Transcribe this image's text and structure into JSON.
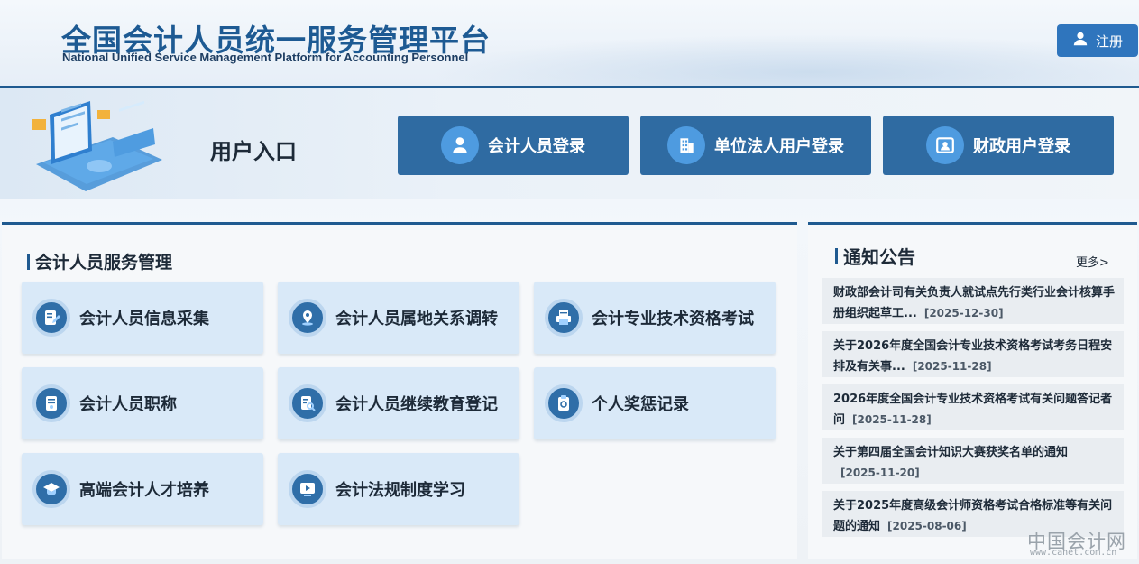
{
  "header": {
    "title": "全国会计人员统一服务管理平台",
    "subtitle": "National Unified Service Management Platform for Accounting Personnel",
    "register_label": "注册"
  },
  "entry": {
    "title": "用户入口",
    "logins": [
      {
        "label": "会计人员登录",
        "icon": "person-icon"
      },
      {
        "label": "单位法人用户登录",
        "icon": "building-icon"
      },
      {
        "label": "财政用户登录",
        "icon": "id-card-icon"
      }
    ]
  },
  "services": {
    "title": "会计人员服务管理",
    "items": [
      {
        "label": "会计人员信息采集",
        "icon": "form-edit-icon"
      },
      {
        "label": "会计人员属地关系调转",
        "icon": "location-icon"
      },
      {
        "label": "会计专业技术资格考试",
        "icon": "printer-icon"
      },
      {
        "label": "会计人员职称",
        "icon": "certificate-icon"
      },
      {
        "label": "会计人员继续教育登记",
        "icon": "document-search-icon"
      },
      {
        "label": "个人奖惩记录",
        "icon": "badge-icon"
      },
      {
        "label": "高端会计人才培养",
        "icon": "graduation-cap-icon"
      },
      {
        "label": "会计法规制度学习",
        "icon": "play-icon"
      }
    ]
  },
  "notices": {
    "title": "通知公告",
    "more": "更多>",
    "items": [
      {
        "text": "财政部会计司有关负责人就试点先行类行业会计核算手册组织起草工...",
        "date": "[2025-12-30]"
      },
      {
        "text": "关于2026年度全国会计专业技术资格考试考务日程安排及有关事...",
        "date": "[2025-11-28]"
      },
      {
        "text": "2026年度全国会计专业技术资格考试有关问题答记者问",
        "date": "[2025-11-28]"
      },
      {
        "text": "关于第四届全国会计知识大赛获奖名单的通知",
        "date": "[2025-11-20]"
      },
      {
        "text": "关于2025年度高级会计师资格考试合格标准等有关问题的通知",
        "date": "[2025-08-06]"
      }
    ]
  },
  "watermark": {
    "text": "中国会计网",
    "url": "www.canet.com.cn"
  },
  "colors": {
    "primary": "#1f5a90",
    "button": "#2f6ba2",
    "card": "#d9e9f8"
  }
}
